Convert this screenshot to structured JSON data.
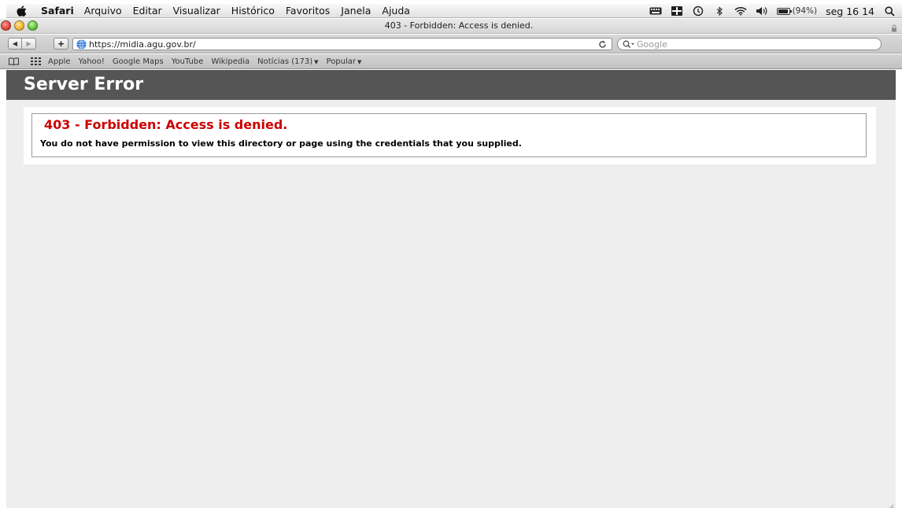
{
  "menubar": {
    "app_name": "Safari",
    "items": [
      "Arquivo",
      "Editar",
      "Visualizar",
      "Histórico",
      "Favoritos",
      "Janela",
      "Ajuda"
    ],
    "battery_percent": "(94%)",
    "clock": "seg 16 14",
    "status_icons": [
      "keyboard-icon",
      "display-icon",
      "time-machine-icon",
      "bluetooth-icon",
      "wifi-icon",
      "volume-icon",
      "battery-icon",
      "spotlight-icon"
    ]
  },
  "window": {
    "title": "403 - Forbidden: Access is denied."
  },
  "toolbar": {
    "add_label": "+",
    "url": "https://midia.agu.gov.br/",
    "search_placeholder": "Google"
  },
  "bookmarks": {
    "items": [
      "Apple",
      "Yahoo!",
      "Google Maps",
      "YouTube",
      "Wikipedia",
      "Notícias (173)",
      "Popular"
    ]
  },
  "page": {
    "header_title": "Server Error",
    "error_heading": "403 - Forbidden: Access is denied.",
    "error_message": "You do not have permission to view this directory or page using the credentials that you supplied.",
    "colors": {
      "header_bg": "#555555",
      "error_red": "#cc0000",
      "page_bg": "#eeeeee"
    }
  }
}
